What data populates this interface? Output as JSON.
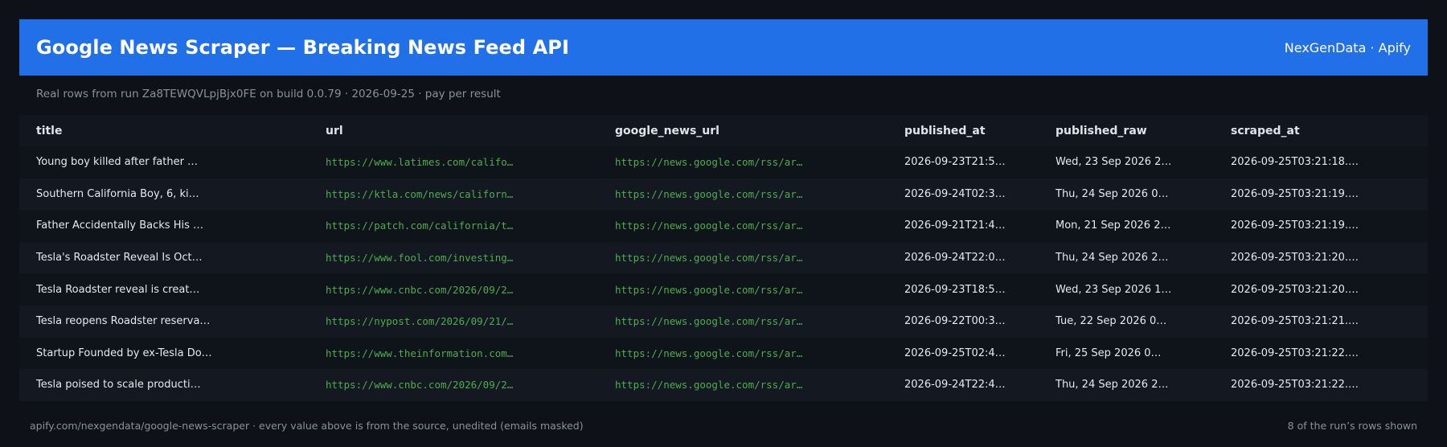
{
  "header": {
    "title": "Google News Scraper — Breaking News Feed API",
    "brand": "NexGenData · Apify"
  },
  "subtitle": "Real rows from run Za8TEWQVLpjBjx0FE on build 0.0.79 · 2026-09-25 · pay per result",
  "table": {
    "columns": [
      "title",
      "url",
      "google_news_url",
      "published_at",
      "published_raw",
      "scraped_at"
    ],
    "rows": [
      [
        "Young boy killed after father …",
        "https://www.latimes.com/califo…",
        "https://news.google.com/rss/ar…",
        "2026-09-23T21:5…",
        "Wed, 23 Sep 2026 2…",
        "2026-09-25T03:21:18.…"
      ],
      [
        "Southern California Boy, 6, ki…",
        "https://ktla.com/news/californ…",
        "https://news.google.com/rss/ar…",
        "2026-09-24T02:3…",
        "Thu, 24 Sep 2026 0…",
        "2026-09-25T03:21:19.…"
      ],
      [
        "Father Accidentally Backs His …",
        "https://patch.com/california/t…",
        "https://news.google.com/rss/ar…",
        "2026-09-21T21:4…",
        "Mon, 21 Sep 2026 2…",
        "2026-09-25T03:21:19.…"
      ],
      [
        "Tesla's Roadster Reveal Is Oct…",
        "https://www.fool.com/investing…",
        "https://news.google.com/rss/ar…",
        "2026-09-24T22:0…",
        "Thu, 24 Sep 2026 2…",
        "2026-09-25T03:21:20.…"
      ],
      [
        "Tesla Roadster reveal is creat…",
        "https://www.cnbc.com/2026/09/2…",
        "https://news.google.com/rss/ar…",
        "2026-09-23T18:5…",
        "Wed, 23 Sep 2026 1…",
        "2026-09-25T03:21:20.…"
      ],
      [
        "Tesla reopens Roadster reserva…",
        "https://nypost.com/2026/09/21/…",
        "https://news.google.com/rss/ar…",
        "2026-09-22T00:3…",
        "Tue, 22 Sep 2026 0…",
        "2026-09-25T03:21:21.…"
      ],
      [
        "Startup Founded by ex-Tesla Do…",
        "https://www.theinformation.com…",
        "https://news.google.com/rss/ar…",
        "2026-09-25T02:4…",
        "Fri, 25 Sep 2026 0…",
        "2026-09-25T03:21:22.…"
      ],
      [
        "Tesla poised to scale producti…",
        "https://www.cnbc.com/2026/09/2…",
        "https://news.google.com/rss/ar…",
        "2026-09-24T22:4…",
        "Thu, 24 Sep 2026 2…",
        "2026-09-25T03:21:22.…"
      ]
    ]
  },
  "footer": {
    "left": "apify.com/nexgendata/google-news-scraper  ·  every value above is from the source, unedited (emails masked)",
    "right": "8 of the run’s rows shown"
  },
  "colors": {
    "background": "#0e1117",
    "header_bg": "#2170e8",
    "link": "#4cae4f",
    "muted": "#8b919b"
  }
}
